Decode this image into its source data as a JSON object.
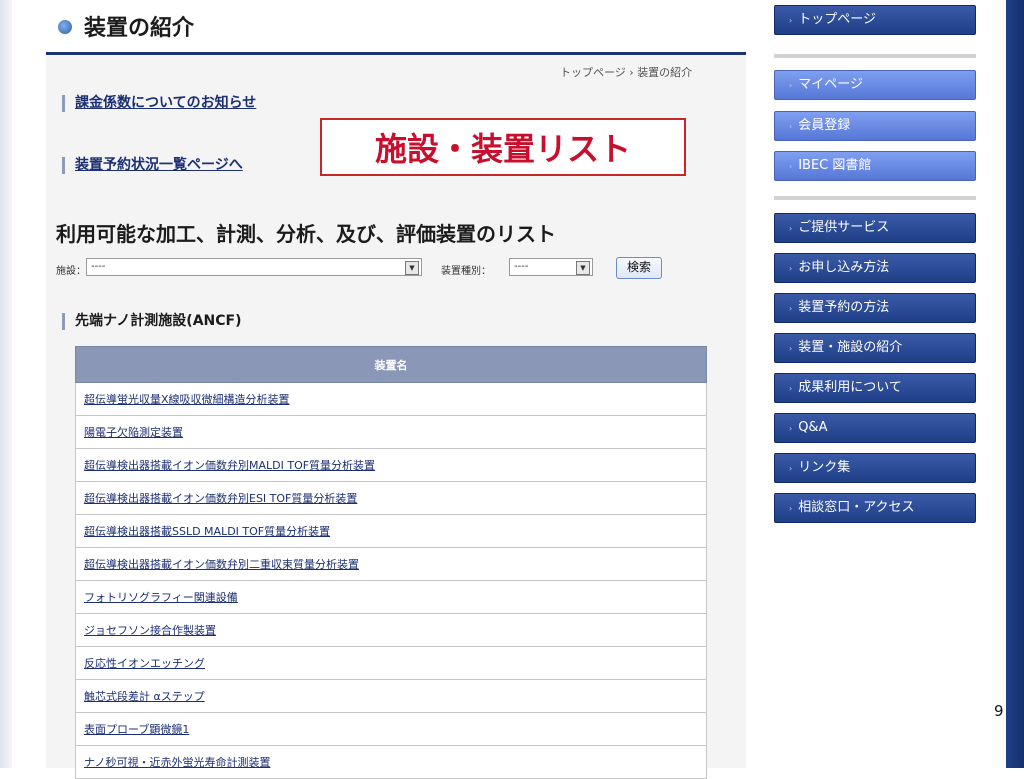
{
  "page": {
    "title": "装置の紹介",
    "breadcrumb": {
      "home": "トップページ",
      "sep": "›",
      "current": "装置の紹介"
    },
    "notice_link": "課金係数についてのお知らせ",
    "reservation_link": "装置予約状況一覧ページへ",
    "overlay_label": "施設・装置リスト",
    "list_heading": "利用可能な加工、計測、分析、及び、評価装置のリスト",
    "slide_number": "9"
  },
  "filters": {
    "facility_label": "施設：",
    "facility_value": "----",
    "type_label": "装置種別：",
    "type_value": "----",
    "search_label": "検索"
  },
  "facility_name": "先端ナノ計測施設(ANCF)",
  "table": {
    "header": "装置名",
    "rows": [
      "超伝導蛍光収量X線吸収微細構造分析装置",
      "陽電子欠陥測定装置",
      "超伝導検出器搭載イオン価数弁別MALDI TOF質量分析装置",
      "超伝導検出器搭載イオン価数弁別ESI TOF質量分析装置",
      "超伝導検出器搭載SSLD MALDI TOF質量分析装置",
      "超伝導検出器搭載イオン価数弁別二重収束質量分析装置",
      "フォトリソグラフィー関連設備",
      "ジョセフソン接合作製装置",
      "反応性イオンエッチング",
      "触芯式段差計 αステップ",
      "表面プローブ顕微鏡1",
      "ナノ秒可視・近赤外蛍光寿命計測装置"
    ]
  },
  "sidebar": {
    "top": "トップページ",
    "group1": [
      "マイページ",
      "会員登録",
      "IBEC 図書館"
    ],
    "group2": [
      "ご提供サービス",
      "お申し込み方法",
      "装置予約の方法",
      "装置・施設の紹介",
      "成果利用について",
      "Q&A",
      "リンク集",
      "相談窓口・アクセス"
    ]
  },
  "colors": {
    "accent": "#1c3372",
    "overlay_red": "#c8102e",
    "table_header": "#8a97b7"
  }
}
